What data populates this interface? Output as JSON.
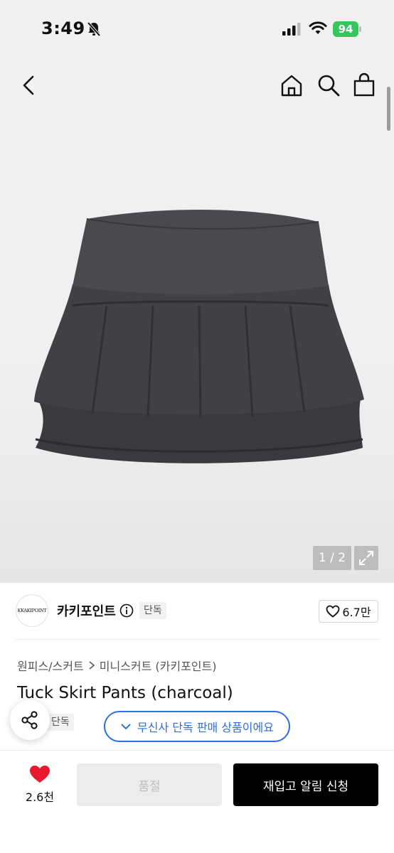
{
  "status_bar": {
    "time": "3:49",
    "battery": "94"
  },
  "gallery": {
    "pager": "1 / 2"
  },
  "brand": {
    "logo_text": "KKAKIPOINT",
    "name": "카키포인트",
    "badge": "단독"
  },
  "like": {
    "count": "6.7만"
  },
  "breadcrumb": {
    "category": "원피스/스커트",
    "subcategory": "미니스커트 (카키포인트)"
  },
  "product": {
    "title": "Tuck Skirt Pants (charcoal)",
    "badge": "단독",
    "musinsa_notice": "무신사 단독 판매 상품이에요"
  },
  "bottom": {
    "heart_count": "2.6천",
    "soldout_label": "품절",
    "restock_label": "재입고 알림 신청"
  },
  "colors": {
    "accent_blue": "#2f6de1",
    "heart_red": "#e8192c",
    "battery_green": "#34c759"
  }
}
